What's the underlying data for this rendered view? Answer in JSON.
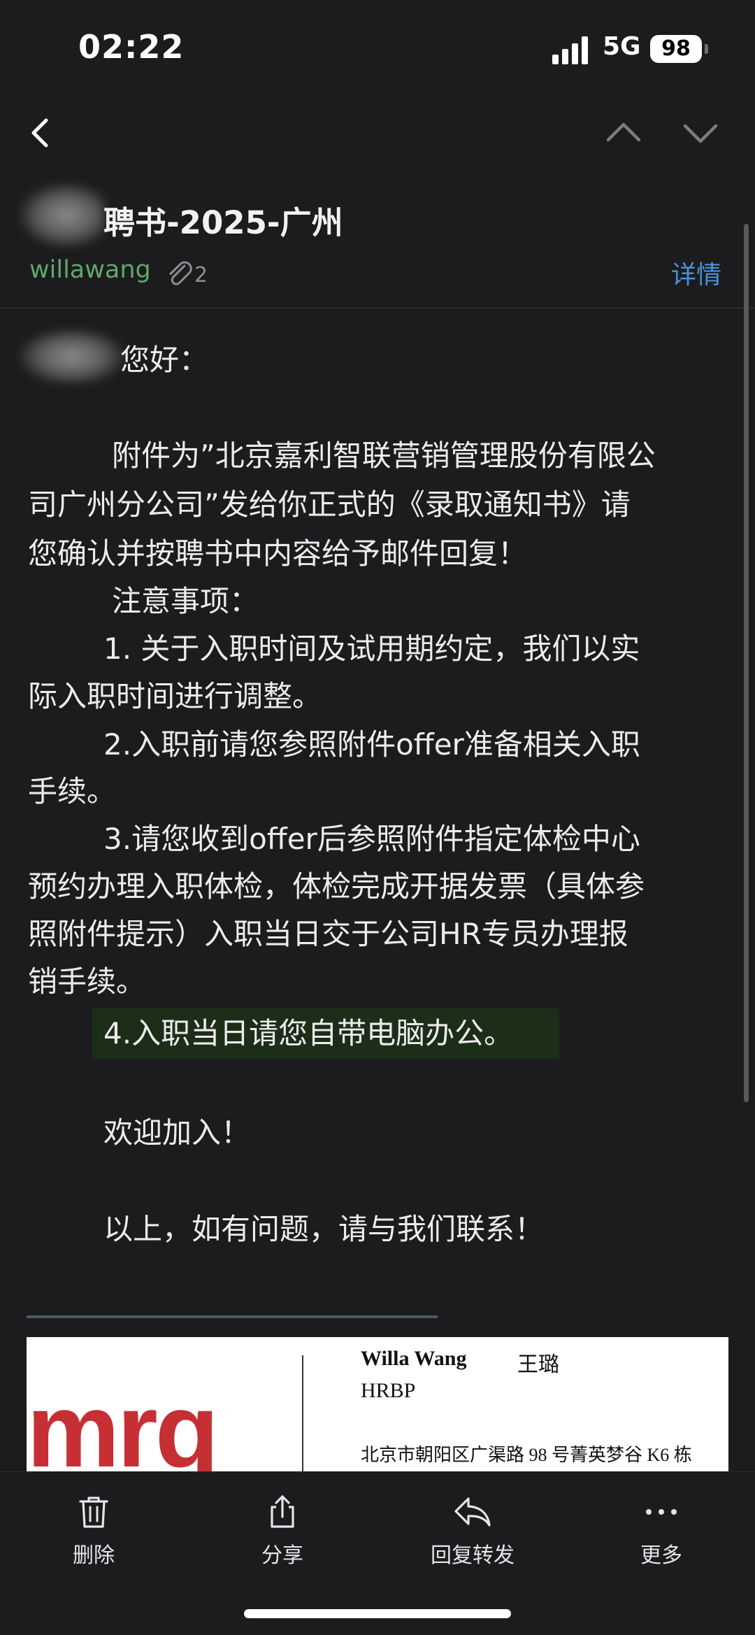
{
  "status_bar": {
    "time": "02:22",
    "network": "5G",
    "battery": "98"
  },
  "header": {
    "subject_visible": "聘书-2025-广州",
    "sender": "willawang",
    "attachment_count": "2",
    "details_label": "详情"
  },
  "body": {
    "greeting": "您好：",
    "lines": [
      "附件为”北京嘉利智联营销管理股份有限公",
      "司广州分公司”发给你正式的《录取通知书》请",
      "您确认并按聘书中内容给予邮件回复！",
      "注意事项：",
      "1. 关于入职时间及试用期约定，我们以实",
      "际入职时间进行调整。",
      "2.入职前请您参照附件offer准备相关入职",
      "手续。",
      "3.请您收到offer后参照附件指定体检中心",
      "预约办理入职体检，体检完成开据发票（具体参",
      "照附件提示）入职当日交于公司HR专员办理报",
      "销手续。",
      "4.入职当日请您自带电脑办公。",
      "欢迎加入！",
      "以上，如有问题，请与我们联系！"
    ]
  },
  "signature": {
    "logo": "mrq",
    "name_en": "Willa Wang",
    "name_cn": "王璐",
    "title": "HRBP",
    "address": "北京市朝阳区广渠路 98 号菁英梦谷 K6 栋"
  },
  "toolbar": {
    "delete": "删除",
    "share": "分享",
    "reply_forward": "回复转发",
    "more": "更多"
  },
  "colors": {
    "background": "#1c1c1e",
    "sender_green": "#5fa868",
    "link_blue": "#4a90d9",
    "logo_red": "#c62f33",
    "highlight": "#1c2e18"
  }
}
